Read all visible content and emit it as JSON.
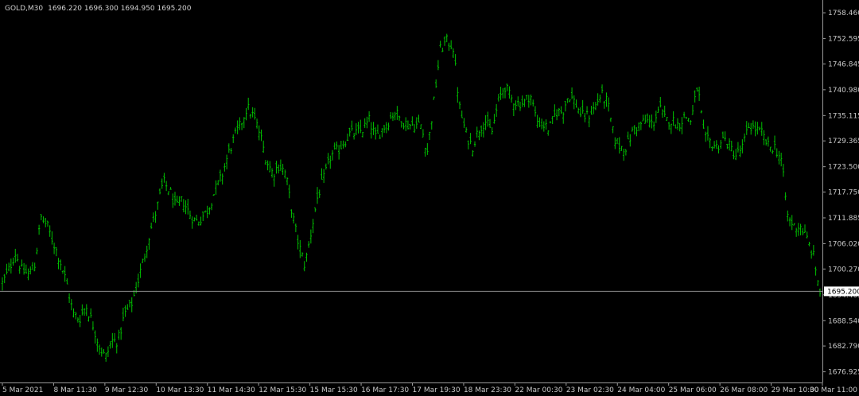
{
  "header": {
    "symbol": "GOLD,M30",
    "ohlc": "1696.220 1696.300 1694.950 1695.200"
  },
  "current_price_label": "1695.200",
  "colors": {
    "background": "#000000",
    "candles": "#00c000",
    "axis": "#9a9a9a",
    "text": "#c8c8c8",
    "price_line": "#8a8a8a",
    "price_tag_bg": "#ffffff"
  },
  "chart_data": {
    "type": "line",
    "title": "GOLD,M30",
    "grid": false,
    "ylim": [
      1674.5,
      1761.0
    ],
    "y_ticks": [
      "1758.460",
      "1752.595",
      "1746.845",
      "1740.980",
      "1735.115",
      "1729.365",
      "1723.500",
      "1717.750",
      "1711.885",
      "1706.020",
      "1700.270",
      "1694.405",
      "1688.540",
      "1682.790",
      "1676.925"
    ],
    "y_tick_values": [
      1758.46,
      1752.595,
      1746.845,
      1740.98,
      1735.115,
      1729.365,
      1723.5,
      1717.75,
      1711.885,
      1706.02,
      1700.27,
      1694.405,
      1688.54,
      1682.79,
      1676.925
    ],
    "x_ticks": [
      "5 Mar 2021",
      "8 Mar 11:30",
      "9 Mar 12:30",
      "10 Mar 13:30",
      "11 Mar 14:30",
      "12 Mar 15:30",
      "15 Mar 15:30",
      "16 Mar 17:30",
      "17 Mar 19:30",
      "18 Mar 23:30",
      "22 Mar 00:30",
      "23 Mar 02:30",
      "24 Mar 04:00",
      "25 Mar 06:00",
      "26 Mar 08:00",
      "29 Mar 10:00",
      "30 Mar 11:00"
    ],
    "current_price": 1695.2,
    "series": [
      {
        "values": [
          1697,
          1700,
          1704,
          1700,
          1699,
          1701,
          1712,
          1710,
          1706,
          1702,
          1697,
          1690,
          1689,
          1692,
          1688,
          1683,
          1680,
          1684,
          1684,
          1690,
          1692,
          1697,
          1703,
          1709,
          1714,
          1720,
          1718,
          1714,
          1716,
          1713,
          1711,
          1712,
          1714,
          1718,
          1721,
          1726,
          1730,
          1733,
          1737,
          1735,
          1731,
          1725,
          1722,
          1724,
          1722,
          1713,
          1706,
          1701,
          1709,
          1717,
          1721,
          1726,
          1727,
          1729,
          1731,
          1731,
          1732,
          1734,
          1730,
          1732,
          1734,
          1736,
          1734,
          1733,
          1733,
          1733,
          1727,
          1738,
          1750,
          1752,
          1751,
          1737,
          1731,
          1728,
          1732,
          1734,
          1731,
          1738,
          1742,
          1739,
          1738,
          1738,
          1740,
          1734,
          1733,
          1732,
          1736,
          1736,
          1740,
          1738,
          1735,
          1735,
          1737,
          1740,
          1738,
          1730,
          1728,
          1728,
          1732,
          1733,
          1734,
          1733,
          1737,
          1734,
          1734,
          1733,
          1735,
          1734,
          1742,
          1730,
          1729,
          1728,
          1730,
          1728,
          1726,
          1728,
          1733,
          1732,
          1731,
          1728,
          1728,
          1725,
          1712,
          1710,
          1710,
          1707,
          1703,
          1695
        ]
      }
    ]
  }
}
